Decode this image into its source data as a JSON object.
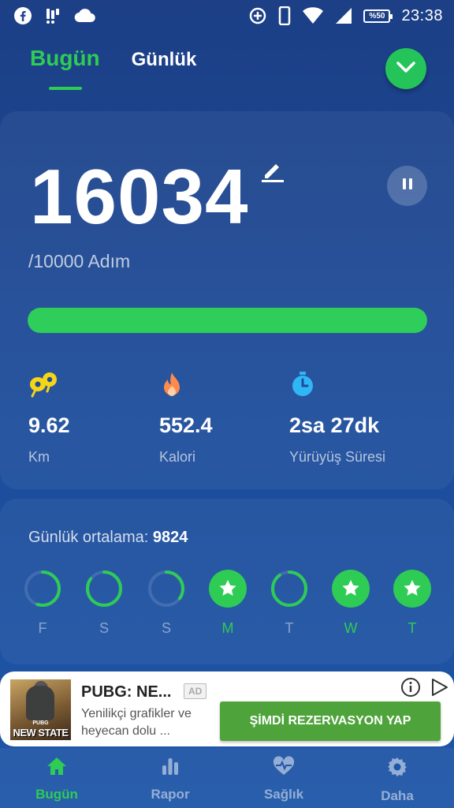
{
  "status_bar": {
    "time": "23:38",
    "battery": "%50",
    "icons": [
      "facebook-icon",
      "notification-icon",
      "cloud-icon",
      "data-saver-icon",
      "phone-icon",
      "wifi-icon",
      "signal-icon"
    ]
  },
  "tabs": [
    {
      "label": "Bugün",
      "active": true
    },
    {
      "label": "Günlük",
      "active": false
    }
  ],
  "steps": {
    "count": "16034",
    "goal_text": "/10000 Adım",
    "progress_fraction": 1.0
  },
  "stats": [
    {
      "icon": "footsteps-icon",
      "value": "9.62",
      "label": "Km",
      "color": "#f5d515"
    },
    {
      "icon": "flame-icon",
      "value": "552.4",
      "label": "Kalori",
      "color": "#ff8a4c"
    },
    {
      "icon": "stopwatch-icon",
      "value": "2sa 27dk",
      "label": "Yürüyüş Süresi",
      "color": "#2fb6f5"
    }
  ],
  "weekly": {
    "average_label": "Günlük ortalama:",
    "average_value": "9824",
    "days": [
      {
        "letter": "F",
        "progress": 0.55,
        "done": false
      },
      {
        "letter": "S",
        "progress": 0.85,
        "done": false
      },
      {
        "letter": "S",
        "progress": 0.35,
        "done": false
      },
      {
        "letter": "M",
        "progress": 1.0,
        "done": true
      },
      {
        "letter": "T",
        "progress": 0.9,
        "done": false
      },
      {
        "letter": "W",
        "progress": 1.0,
        "done": true
      },
      {
        "letter": "T",
        "progress": 1.0,
        "done": true
      }
    ]
  },
  "ad": {
    "image_small_text": "PUBG",
    "image_brand": "NEW STATE",
    "title": "PUBG: NE...",
    "badge": "AD",
    "description": "Yenilikçi grafikler ve heyecan dolu ...",
    "cta": "ŞİMDİ REZERVASYON YAP"
  },
  "nav": [
    {
      "label": "Bugün",
      "icon": "home-icon",
      "active": true
    },
    {
      "label": "Rapor",
      "icon": "bar-chart-icon",
      "active": false
    },
    {
      "label": "Sağlık",
      "icon": "heart-pulse-icon",
      "active": false
    },
    {
      "label": "Daha",
      "icon": "gear-icon",
      "active": false
    }
  ],
  "colors": {
    "accent": "#2ecc55",
    "background": "#1d4c9a"
  }
}
